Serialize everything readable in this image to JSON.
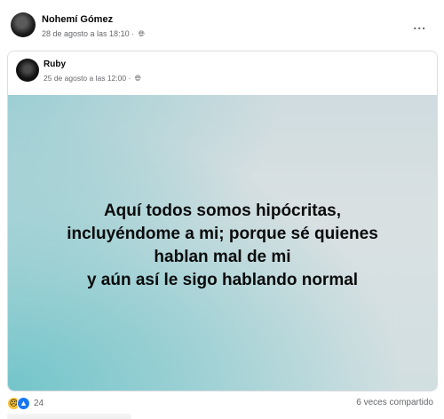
{
  "post": {
    "author_name": "Nohemí Gómez",
    "timestamp": "28 de agosto a las 18:10 ·",
    "privacy_icon": "globe-icon",
    "more_icon": "more-options-icon",
    "more_label": "..."
  },
  "shared_post": {
    "author_name": "Ruby",
    "timestamp": "25 de agosto a las 12:00 ·",
    "privacy_icon": "globe-icon",
    "text_lines": [
      "Aquí todos somos hipócritas,",
      "incluyéndome a mi; porque sé quienes",
      "hablan mal de mi",
      "y aún así le sigo hablando normal"
    ],
    "background_colors": [
      "#6ec4c9",
      "#d9e0e2"
    ]
  },
  "footer": {
    "reactions": [
      "sad-reaction-icon",
      "like-reaction-icon"
    ],
    "reaction_count": "24",
    "shares_label": "6 veces compartido"
  },
  "colors": {
    "text_primary": "#050505",
    "text_secondary": "#65676b",
    "like_blue": "#1877f2",
    "sad_yellow": "#f5c33b"
  }
}
